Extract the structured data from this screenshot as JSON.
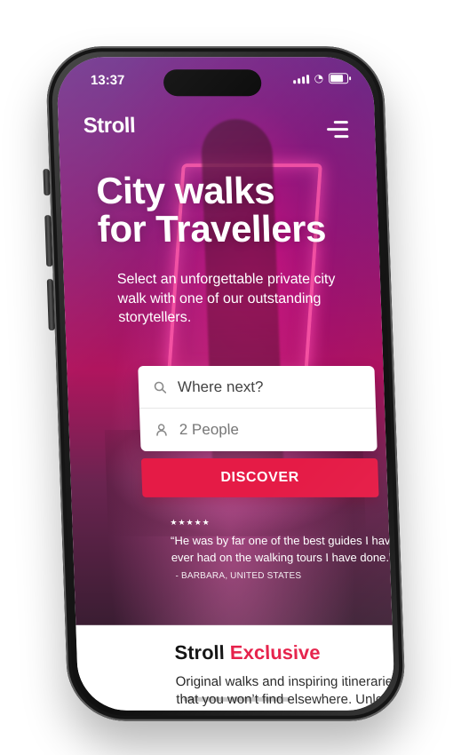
{
  "status_bar": {
    "time": "13:37"
  },
  "header": {
    "brand": "Stroll",
    "menu_icon": "menu-icon"
  },
  "hero": {
    "headline": [
      "City walks",
      "for Travellers"
    ],
    "subhead": "Select an unforgettable private city walk with one of our outstanding storytellers."
  },
  "search": {
    "destination_placeholder": "Where next?",
    "people_value": "2 People",
    "button_label": "DISCOVER",
    "icons": {
      "destination": "search-icon",
      "people": "person-icon"
    }
  },
  "testimonial": {
    "rating": "★★★★★",
    "quote": "“He was by far one of the best guides I have ever had on the walking tours I have done.”",
    "author": "- BARBARA, UNITED STATES"
  },
  "exclusive": {
    "title_prefix": "Stroll",
    "title_accent": "Exclusive",
    "copy": "Original walks and inspiring itineraries that you won’t find elsewhere. Unlock the city!"
  },
  "colors": {
    "accent": "#e51b46",
    "hero_purple": "#6a2b88",
    "hero_magenta": "#b0155e",
    "text_dark": "#111111"
  }
}
